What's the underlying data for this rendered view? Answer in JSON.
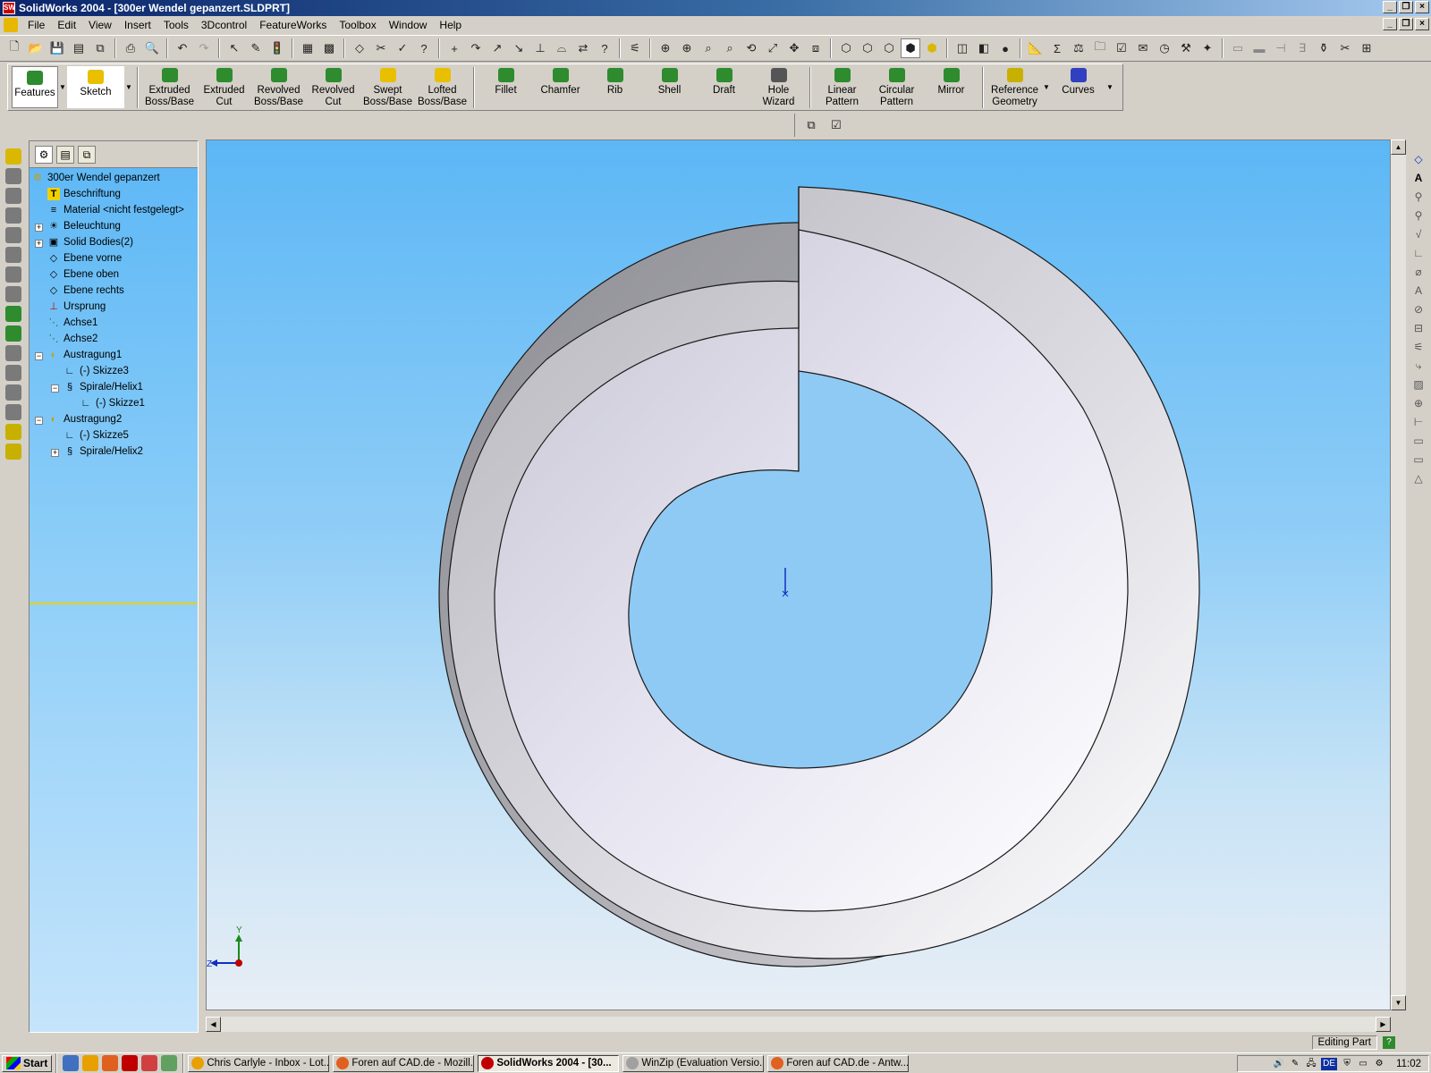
{
  "window": {
    "title": "SolidWorks 2004 - [300er Wendel gepanzert.SLDPRT]",
    "app_icon_text": "SW"
  },
  "menu": [
    "File",
    "Edit",
    "View",
    "Insert",
    "Tools",
    "3Dcontrol",
    "FeatureWorks",
    "Toolbox",
    "Window",
    "Help"
  ],
  "features_toolbar": {
    "features_label": "Features",
    "sketch_label": "Sketch",
    "buttons": [
      {
        "label": "Extruded\nBoss/Base",
        "color": "#2e8b2e"
      },
      {
        "label": "Extruded\nCut",
        "color": "#2e8b2e"
      },
      {
        "label": "Revolved\nBoss/Base",
        "color": "#2e8b2e"
      },
      {
        "label": "Revolved\nCut",
        "color": "#2e8b2e"
      },
      {
        "label": "Swept\nBoss/Base",
        "color": "#e8c000"
      },
      {
        "label": "Lofted\nBoss/Base",
        "color": "#e8c000"
      },
      {
        "label": "Fillet",
        "color": "#2e8b2e"
      },
      {
        "label": "Chamfer",
        "color": "#2e8b2e"
      },
      {
        "label": "Rib",
        "color": "#2e8b2e"
      },
      {
        "label": "Shell",
        "color": "#2e8b2e"
      },
      {
        "label": "Draft",
        "color": "#2e8b2e"
      },
      {
        "label": "Hole\nWizard",
        "color": "#555555"
      },
      {
        "label": "Linear\nPattern",
        "color": "#2e8b2e"
      },
      {
        "label": "Circular\nPattern",
        "color": "#2e8b2e"
      },
      {
        "label": "Mirror",
        "color": "#2e8b2e"
      },
      {
        "label": "Reference\nGeometry",
        "color": "#c8b000"
      },
      {
        "label": "Curves",
        "color": "#3040c0"
      }
    ]
  },
  "feature_tree": {
    "root": "300er Wendel gepanzert",
    "items": [
      {
        "label": "Beschriftung",
        "icon": "annotation-icon",
        "glyph": "T",
        "level": 1,
        "expander": ""
      },
      {
        "label": "Material <nicht festgelegt>",
        "icon": "material-icon",
        "glyph": "≡",
        "level": 1,
        "expander": ""
      },
      {
        "label": "Beleuchtung",
        "icon": "lighting-icon",
        "glyph": "☀",
        "level": 1,
        "expander": "+"
      },
      {
        "label": "Solid Bodies(2)",
        "icon": "solid-bodies-icon",
        "glyph": "▣",
        "level": 1,
        "expander": "+"
      },
      {
        "label": "Ebene vorne",
        "icon": "plane-icon",
        "glyph": "◇",
        "level": 1,
        "expander": ""
      },
      {
        "label": "Ebene oben",
        "icon": "plane-icon",
        "glyph": "◇",
        "level": 1,
        "expander": ""
      },
      {
        "label": "Ebene rechts",
        "icon": "plane-icon",
        "glyph": "◇",
        "level": 1,
        "expander": ""
      },
      {
        "label": "Ursprung",
        "icon": "origin-icon",
        "glyph": "⊥",
        "level": 1,
        "expander": ""
      },
      {
        "label": "Achse1",
        "icon": "axis-icon",
        "glyph": "⋱",
        "level": 1,
        "expander": ""
      },
      {
        "label": "Achse2",
        "icon": "axis-icon",
        "glyph": "⋱",
        "level": 1,
        "expander": ""
      },
      {
        "label": "Austragung1",
        "icon": "sweep-icon",
        "glyph": "◐",
        "level": 1,
        "expander": "−"
      },
      {
        "label": "(-) Skizze3",
        "icon": "sketch-icon",
        "glyph": "∟",
        "level": 2,
        "expander": ""
      },
      {
        "label": "Spirale/Helix1",
        "icon": "helix-icon",
        "glyph": "§",
        "level": 2,
        "expander": "−"
      },
      {
        "label": "(-) Skizze1",
        "icon": "sketch-icon",
        "glyph": "∟",
        "level": 3,
        "expander": ""
      },
      {
        "label": "Austragung2",
        "icon": "sweep-icon",
        "glyph": "◐",
        "level": 1,
        "expander": "−"
      },
      {
        "label": "(-) Skizze5",
        "icon": "sketch-icon",
        "glyph": "∟",
        "level": 2,
        "expander": ""
      },
      {
        "label": "Spirale/Helix2",
        "icon": "helix-icon",
        "glyph": "§",
        "level": 2,
        "expander": "+"
      }
    ]
  },
  "triad": {
    "y_label": "Y",
    "z_label": "Z"
  },
  "status": {
    "text": "Editing Part"
  },
  "taskbar": {
    "start_label": "Start",
    "tasks": [
      {
        "label": "Chris Carlyle - Inbox - Lot...",
        "color": "#e8a000",
        "active": false
      },
      {
        "label": "Foren auf CAD.de - Mozill...",
        "color": "#e06020",
        "active": false
      },
      {
        "label": "SolidWorks 2004 - [30...",
        "color": "#c00000",
        "active": true
      },
      {
        "label": "WinZip (Evaluation Versio...",
        "color": "#a0a0a0",
        "active": false
      },
      {
        "label": "Foren auf CAD.de - Antw...",
        "color": "#e06020",
        "active": false
      }
    ],
    "tray_lang": "DE",
    "clock": "11:02"
  }
}
